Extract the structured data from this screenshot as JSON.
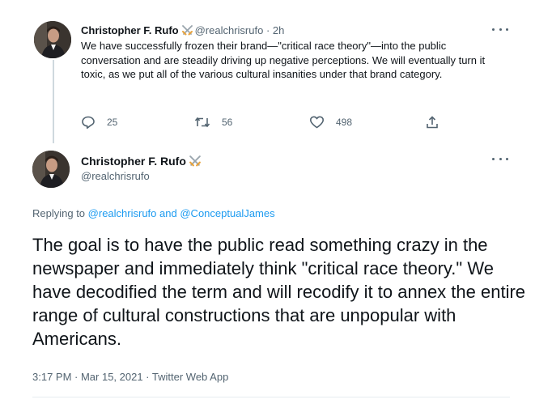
{
  "tweet1": {
    "name": "Christopher F. Rufo",
    "handle": "@realchrisrufo",
    "time": "· 2h",
    "text": "We have successfully frozen their brand—\"critical race theory\"—into the public conversation and are steadily driving up negative perceptions. We will eventually turn it toxic, as we put all of the various cultural insanities under that brand category.",
    "actions": {
      "replies": "25",
      "retweets": "56",
      "likes": "498"
    },
    "icons": [
      "crossed-swords-icon",
      "more-icon",
      "reply-icon",
      "retweet-icon",
      "like-icon",
      "share-icon"
    ]
  },
  "tweet2": {
    "name": "Christopher F. Rufo",
    "handle": "@realchrisrufo",
    "replying_prefix": "Replying to",
    "replying_user1": "@realchrisrufo",
    "replying_and": "and",
    "replying_user2": "@ConceptualJames",
    "text": "The goal is to have the public read something crazy in the newspaper and immediately think \"critical race theory.\" We have decodified the term and will recodify it to annex the entire range of cultural constructions that are unpopular with Americans.",
    "timestamp": "3:17 PM · Mar 15, 2021 · Twitter Web App"
  },
  "colors": {
    "text": "#0f1419",
    "secondary": "#536471",
    "link": "#1d9bf0",
    "sword_blade": "#9aa5ad",
    "sword_hilt": "#e8a33d"
  }
}
